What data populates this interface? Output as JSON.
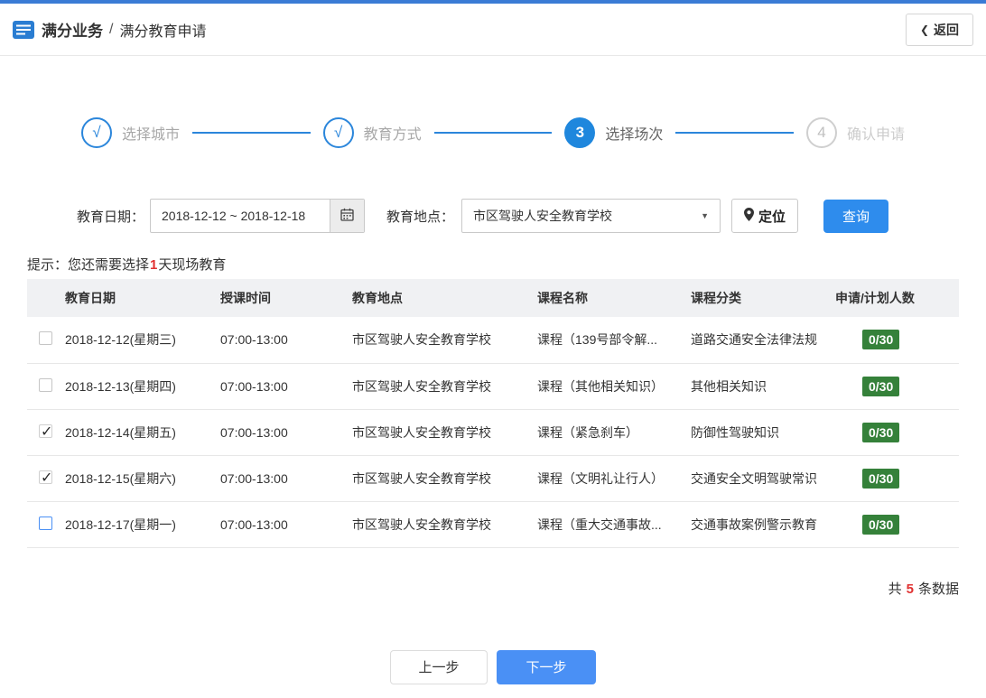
{
  "colors": {
    "topbar_blue": "#3a7bd5",
    "step_blue": "#2186d8",
    "search_button_blue": "#2e8ced",
    "next_button_blue": "#4a90f5",
    "badge_green": "#35813a",
    "highlight_red": "#e03131"
  },
  "icons": {
    "breadcrumb": "menu-list-icon",
    "back_chevron": "❮",
    "calendar": "calendar-icon",
    "caret": "▼",
    "location_pin": "location-pin-icon",
    "check": "✓"
  },
  "header": {
    "breadcrumb_root": "满分业务",
    "breadcrumb_separator": "/",
    "breadcrumb_current": "满分教育申请",
    "back_label": "返回"
  },
  "stepper": {
    "steps": [
      {
        "marker": "√",
        "label": "选择城市",
        "state": "done"
      },
      {
        "marker": "√",
        "label": "教育方式",
        "state": "done"
      },
      {
        "marker": "3",
        "label": "选择场次",
        "state": "active"
      },
      {
        "marker": "4",
        "label": "确认申请",
        "state": "pending"
      }
    ]
  },
  "filters": {
    "date_label": "教育日期：",
    "date_value": "2018-12-12 ~ 2018-12-18",
    "location_label": "教育地点：",
    "location_value": "市区驾驶人安全教育学校",
    "locate_label": "定位",
    "search_label": "查询"
  },
  "hint": {
    "prefix": "提示：您还需要选择",
    "highlight": "1",
    "suffix": "天现场教育"
  },
  "table": {
    "headers": [
      "教育日期",
      "授课时间",
      "教育地点",
      "课程名称",
      "课程分类",
      "申请/计划人数"
    ],
    "rows": [
      {
        "checkbox": "unchecked",
        "date": "2018-12-12(星期三)",
        "time": "07:00-13:00",
        "location": "市区驾驶人安全教育学校",
        "course": "课程（139号部令解...",
        "category": "道路交通安全法律法规",
        "quota": "0/30"
      },
      {
        "checkbox": "unchecked",
        "date": "2018-12-13(星期四)",
        "time": "07:00-13:00",
        "location": "市区驾驶人安全教育学校",
        "course": "课程（其他相关知识）",
        "category": "其他相关知识",
        "quota": "0/30"
      },
      {
        "checkbox": "checked",
        "date": "2018-12-14(星期五)",
        "time": "07:00-13:00",
        "location": "市区驾驶人安全教育学校",
        "course": "课程（紧急刹车）",
        "category": "防御性驾驶知识",
        "quota": "0/30"
      },
      {
        "checkbox": "checked",
        "date": "2018-12-15(星期六)",
        "time": "07:00-13:00",
        "location": "市区驾驶人安全教育学校",
        "course": "课程（文明礼让行人）",
        "category": "交通安全文明驾驶常识",
        "quota": "0/30"
      },
      {
        "checkbox": "focused",
        "date": "2018-12-17(星期一)",
        "time": "07:00-13:00",
        "location": "市区驾驶人安全教育学校",
        "course": "课程（重大交通事故...",
        "category": "交通事故案例警示教育",
        "quota": "0/30"
      }
    ]
  },
  "footer": {
    "total_prefix": "共",
    "total_count": "5",
    "total_suffix": "条数据"
  },
  "actions": {
    "prev_label": "上一步",
    "next_label": "下一步"
  }
}
